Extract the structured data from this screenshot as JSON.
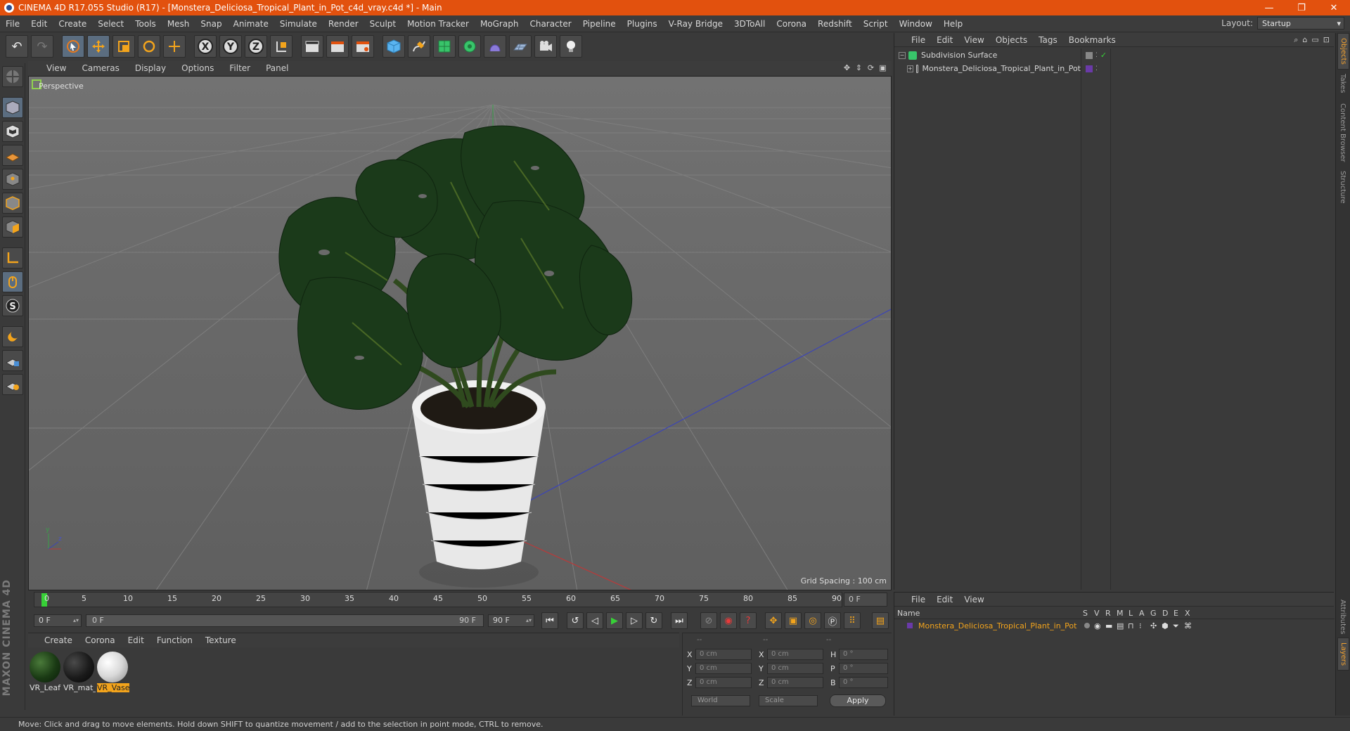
{
  "window": {
    "title": "CINEMA 4D R17.055 Studio (R17) - [Monstera_Deliciosa_Tropical_Plant_in_Pot_c4d_vray.c4d *] - Main",
    "minimize_glyph": "—",
    "restore_glyph": "❐",
    "close_glyph": "✕"
  },
  "menubar": {
    "items": [
      "File",
      "Edit",
      "Create",
      "Select",
      "Tools",
      "Mesh",
      "Snap",
      "Animate",
      "Simulate",
      "Render",
      "Sculpt",
      "Motion Tracker",
      "MoGraph",
      "Character",
      "Pipeline",
      "Plugins",
      "V-Ray Bridge",
      "3DToAll",
      "Corona",
      "Redshift",
      "Script",
      "Window",
      "Help"
    ],
    "layout_label": "Layout:",
    "layout_value": "Startup"
  },
  "toolbar": {
    "axis_x": "X",
    "axis_y": "Y",
    "axis_z": "Z"
  },
  "viewport": {
    "menu": [
      "View",
      "Cameras",
      "Display",
      "Options",
      "Filter",
      "Panel"
    ],
    "label": "Perspective",
    "grid_spacing": "Grid Spacing : 100 cm",
    "axis_y": "y",
    "axis_z": "z"
  },
  "timeline": {
    "ticks": [
      "0",
      "5",
      "10",
      "15",
      "20",
      "25",
      "30",
      "35",
      "40",
      "45",
      "50",
      "55",
      "60",
      "65",
      "70",
      "75",
      "80",
      "85",
      "90"
    ],
    "current_frame": "0 F",
    "start_field": "0 F",
    "range_start": "0 F",
    "range_end": "90 F",
    "end_field": "90 F"
  },
  "materials": {
    "menu": [
      "Create",
      "Corona",
      "Edit",
      "Function",
      "Texture"
    ],
    "items": [
      {
        "name": "VR_Leaf",
        "selected": false
      },
      {
        "name": "VR_mat_",
        "selected": false
      },
      {
        "name": "VR_Vase",
        "selected": true
      }
    ]
  },
  "coords": {
    "headers": [
      "--",
      "--",
      "--"
    ],
    "rows": [
      {
        "a": "X",
        "av": "0 cm",
        "b": "X",
        "bv": "0 cm",
        "c": "H",
        "cv": "0 °"
      },
      {
        "a": "Y",
        "av": "0 cm",
        "b": "Y",
        "bv": "0 cm",
        "c": "P",
        "cv": "0 °"
      },
      {
        "a": "Z",
        "av": "0 cm",
        "b": "Z",
        "bv": "0 cm",
        "c": "B",
        "cv": "0 °"
      }
    ],
    "space": "World",
    "mode": "Scale",
    "apply": "Apply"
  },
  "status": {
    "text": "Move: Click and drag to move elements. Hold down SHIFT to quantize movement / add to the selection in point mode, CTRL to remove."
  },
  "objects": {
    "menu": [
      "File",
      "Edit",
      "View",
      "Objects",
      "Tags",
      "Bookmarks"
    ],
    "items": [
      {
        "name": "Subdivision Surface"
      },
      {
        "name": "Monstera_Deliciosa_Tropical_Plant_in_Pot"
      }
    ]
  },
  "layers": {
    "menu": [
      "File",
      "Edit",
      "View"
    ],
    "header_name": "Name",
    "columns": [
      "S",
      "V",
      "R",
      "M",
      "L",
      "A",
      "G",
      "D",
      "E",
      "X"
    ],
    "row": "Monstera_Deliciosa_Tropical_Plant_in_Pot"
  },
  "sidetabs": [
    "Objects",
    "Takes",
    "Content Browser",
    "Structure",
    "Attributes",
    "Layers"
  ],
  "logo": "MAXON CINEMA 4D",
  "colors": {
    "titlebar": "#e2510e",
    "accent": "#f3a41c",
    "playhead": "#37d137"
  }
}
